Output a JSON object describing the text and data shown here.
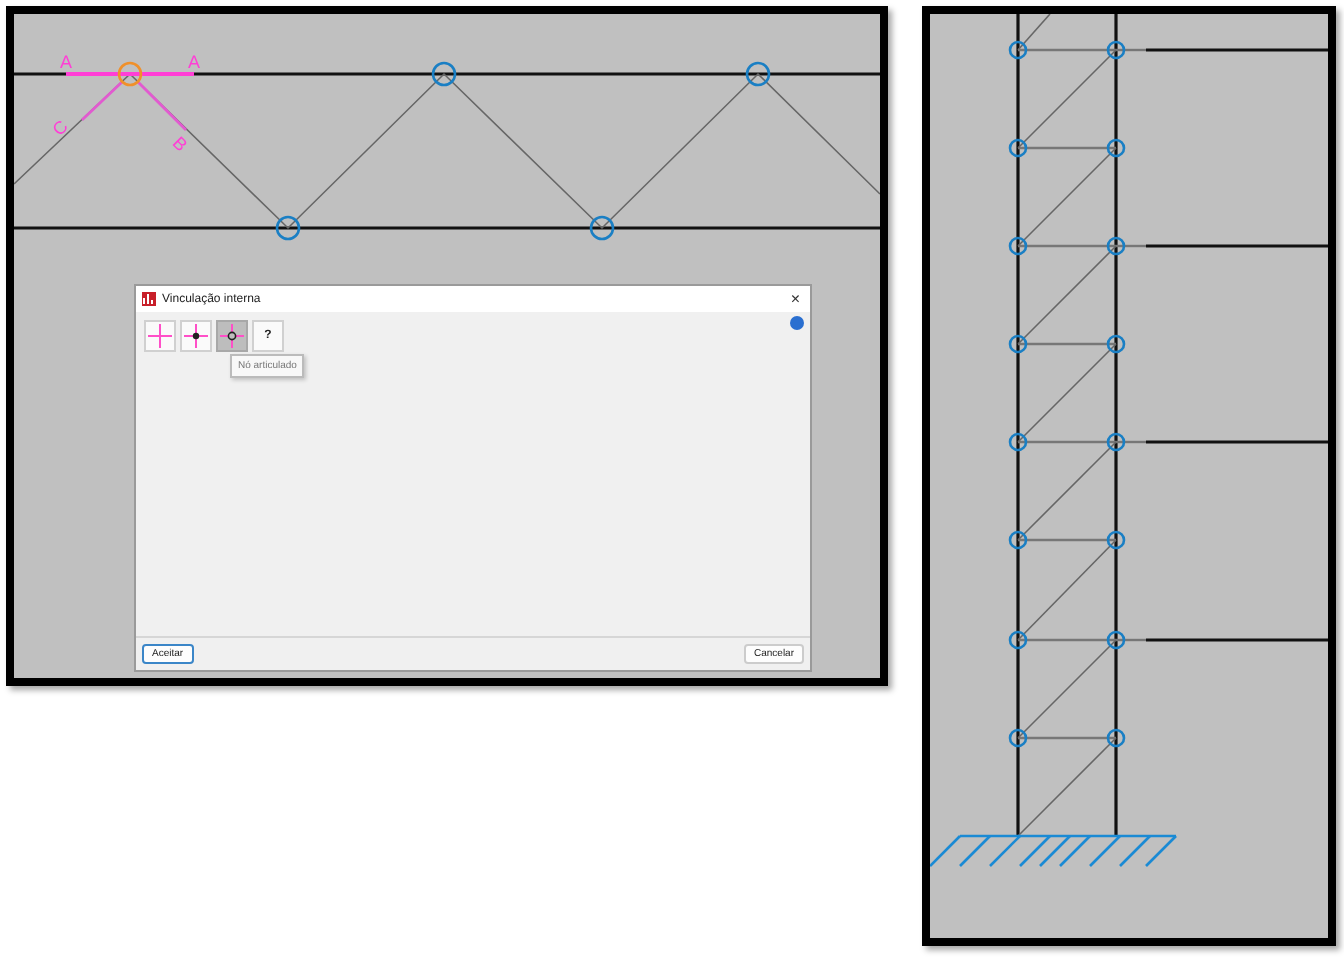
{
  "canvas": {
    "labels": [
      "A",
      "A",
      "C",
      "B"
    ]
  },
  "dialog": {
    "title": "Vinculação interna",
    "close": "×",
    "tools": [
      {
        "kind": "cross",
        "selected": false
      },
      {
        "kind": "fixed",
        "selected": false
      },
      {
        "kind": "hinged",
        "selected": true
      },
      {
        "kind": "help",
        "label": "?",
        "selected": false
      }
    ],
    "tooltip": "Nó articulado",
    "buttons": [
      {
        "label": "Aceitar",
        "focused": true
      },
      {
        "label": "Cancelar",
        "focused": false
      }
    ]
  }
}
